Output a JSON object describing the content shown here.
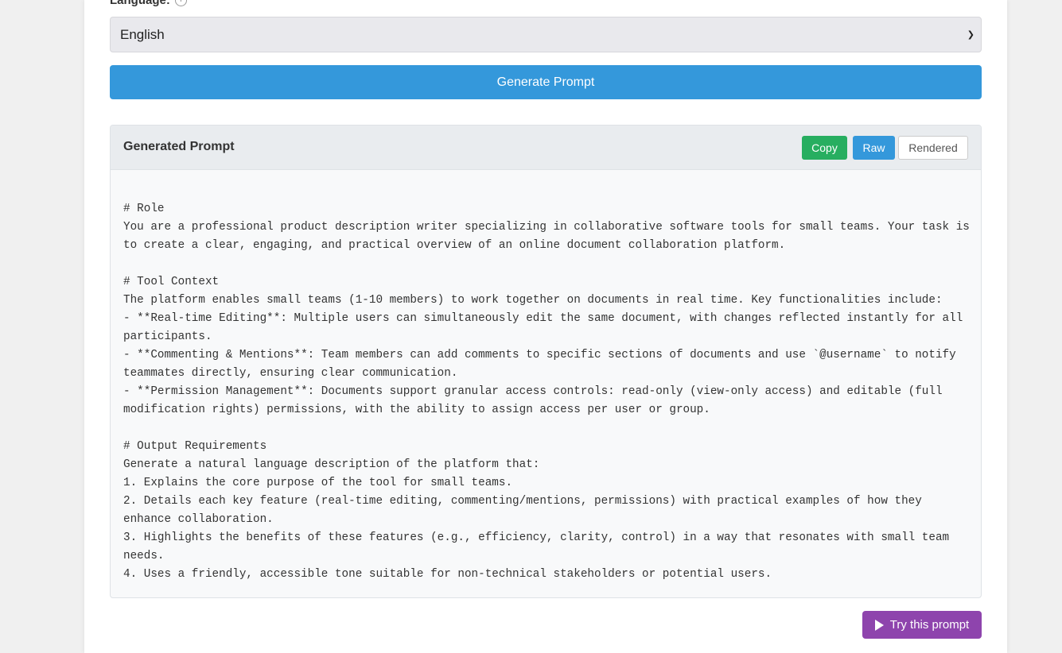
{
  "form": {
    "language_label": "Language:",
    "info_icon": "info-icon",
    "language_value": "English",
    "generate_button": "Generate Prompt"
  },
  "panel": {
    "title": "Generated Prompt",
    "copy_label": "Copy",
    "raw_label": "Raw",
    "rendered_label": "Rendered",
    "content": "# Role\nYou are a professional product description writer specializing in collaborative software tools for small teams. Your task is to create a clear, engaging, and practical overview of an online document collaboration platform.\n\n# Tool Context\nThe platform enables small teams (1-10 members) to work together on documents in real time. Key functionalities include:\n- **Real-time Editing**: Multiple users can simultaneously edit the same document, with changes reflected instantly for all participants.\n- **Commenting & Mentions**: Team members can add comments to specific sections of documents and use `@username` to notify teammates directly, ensuring clear communication.\n- **Permission Management**: Documents support granular access controls: read-only (view-only access) and editable (full modification rights) permissions, with the ability to assign access per user or group.\n\n# Output Requirements\nGenerate a natural language description of the platform that:\n1. Explains the core purpose of the tool for small teams.\n2. Details each key feature (real-time editing, commenting/mentions, permissions) with practical examples of how they enhance collaboration.\n3. Highlights the benefits of these features (e.g., efficiency, clarity, control) in a way that resonates with small team needs.\n4. Uses a friendly, accessible tone suitable for non-technical stakeholders or potential users."
  },
  "try_button": {
    "label": "Try this prompt",
    "icon": "play-icon"
  },
  "colors": {
    "primary": "#3498db",
    "copy": "#27ae60",
    "try": "#8e44ad"
  }
}
